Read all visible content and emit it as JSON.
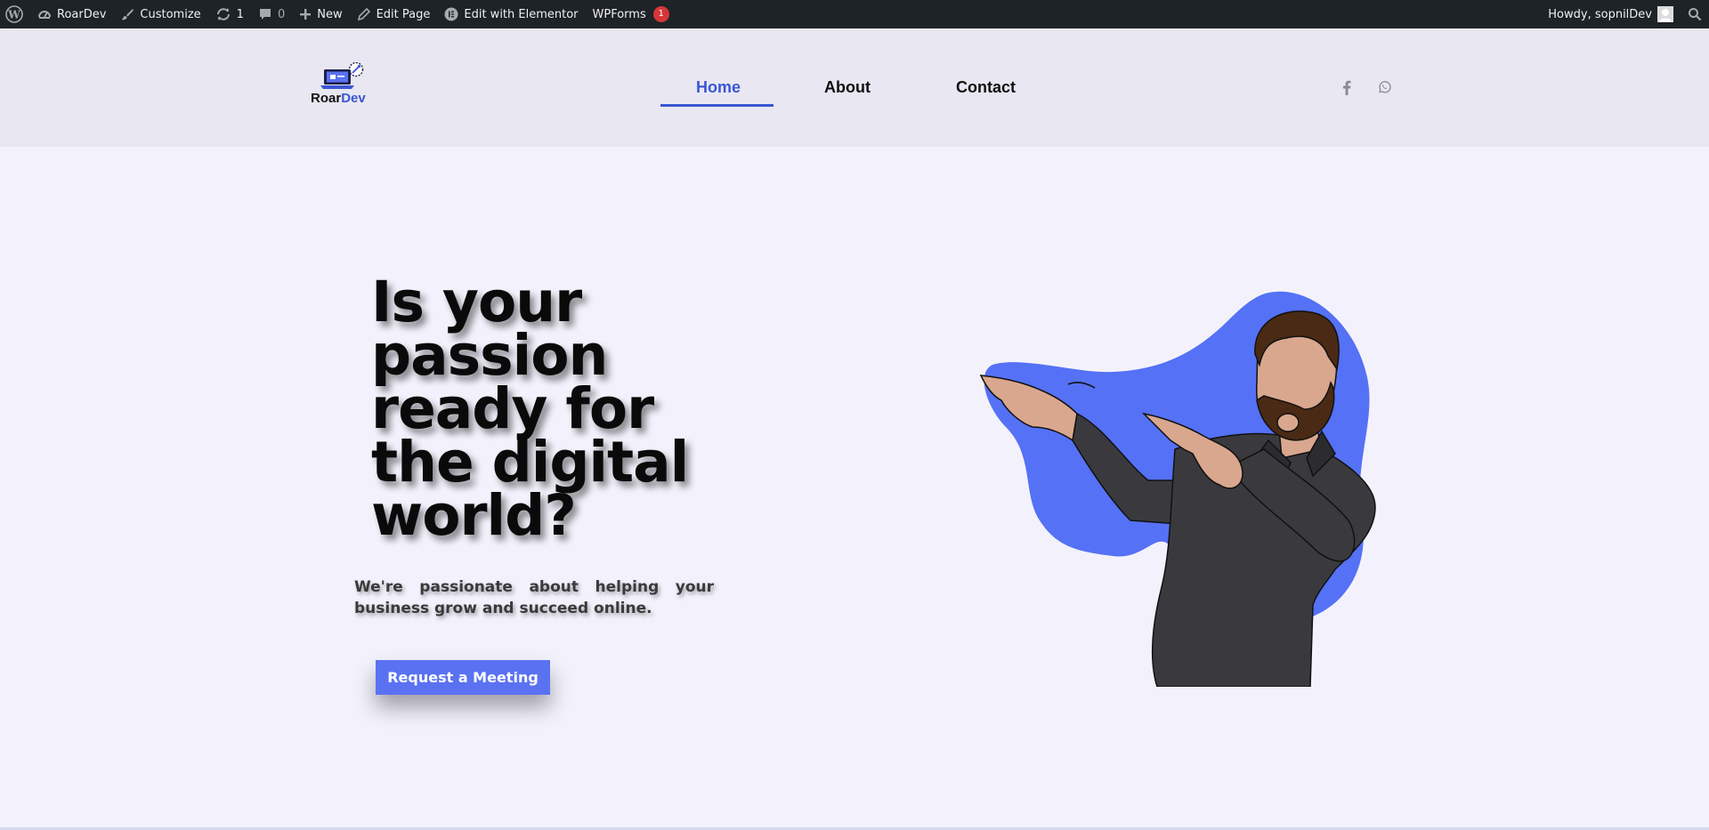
{
  "admin_bar": {
    "site_name": "RoarDev",
    "customize": "Customize",
    "updates_count": "1",
    "comments_count": "0",
    "new": "New",
    "edit_page": "Edit Page",
    "edit_elementor": "Edit with Elementor",
    "wpforms": "WPForms",
    "wpforms_badge": "1",
    "howdy": "Howdy, sopnilDev"
  },
  "header": {
    "logo_text_primary": "Roar",
    "logo_text_accent": "Dev",
    "nav": [
      {
        "label": "Home",
        "active": true
      },
      {
        "label": "About",
        "active": false
      },
      {
        "label": "Contact",
        "active": false
      }
    ],
    "social_icons": [
      "facebook-icon",
      "whatsapp-icon"
    ]
  },
  "hero": {
    "title": "Is your passion ready for the digital world?",
    "subtitle": "We're passionate about helping your business grow and succeed online.",
    "cta_label": "Request a Meeting"
  },
  "colors": {
    "accent": "#3a56d4",
    "button": "#5a72f2",
    "blob": "#5571f5",
    "admin_bar": "#1d2327",
    "header_bg": "#e9e7f1",
    "page_bg": "#f3f2fc"
  }
}
